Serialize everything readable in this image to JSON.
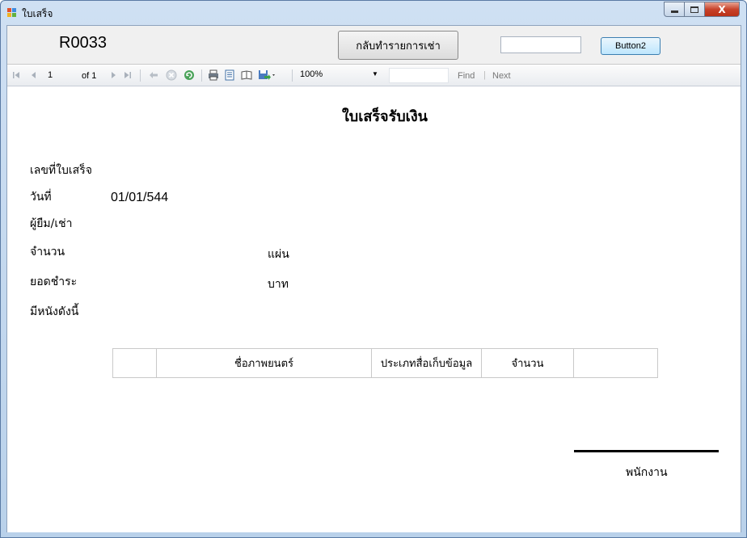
{
  "window": {
    "title": "ใบเสร็จ",
    "icon": "app-window-icon",
    "controls": {
      "minimize": "—",
      "maximize": "□",
      "close": "X"
    }
  },
  "top_panel": {
    "receipt_id": "R0033",
    "back_button_label": "กลับทำรายการเช่า",
    "text_input_value": "",
    "button2_label": "Button2"
  },
  "report_toolbar": {
    "page_number": "1",
    "of_pages": "of 1",
    "zoom": "100%",
    "find_value": "",
    "find_label": "Find",
    "separator": "|",
    "next_label": "Next"
  },
  "report": {
    "title": "ใบเสร็จรับเงิน",
    "fields": {
      "receipt_no_label": "เลขที่ใบเสร็จ",
      "date_label": "วันที่",
      "date_value": "01/01/544",
      "borrower_label": "ผู้ยืม/เช่า",
      "quantity_label": "จำนวน",
      "quantity_unit": "แผ่น",
      "amount_label": "ยอดชำระ",
      "amount_unit": "บาท",
      "items_label": "มีหนังดังนี้"
    },
    "table": {
      "columns": [
        "",
        "ชื่อภาพยนตร์",
        "ประเภทสื่อเก็บข้อมูล",
        "จำนวน",
        ""
      ]
    },
    "signature_label": "พนักงาน"
  }
}
